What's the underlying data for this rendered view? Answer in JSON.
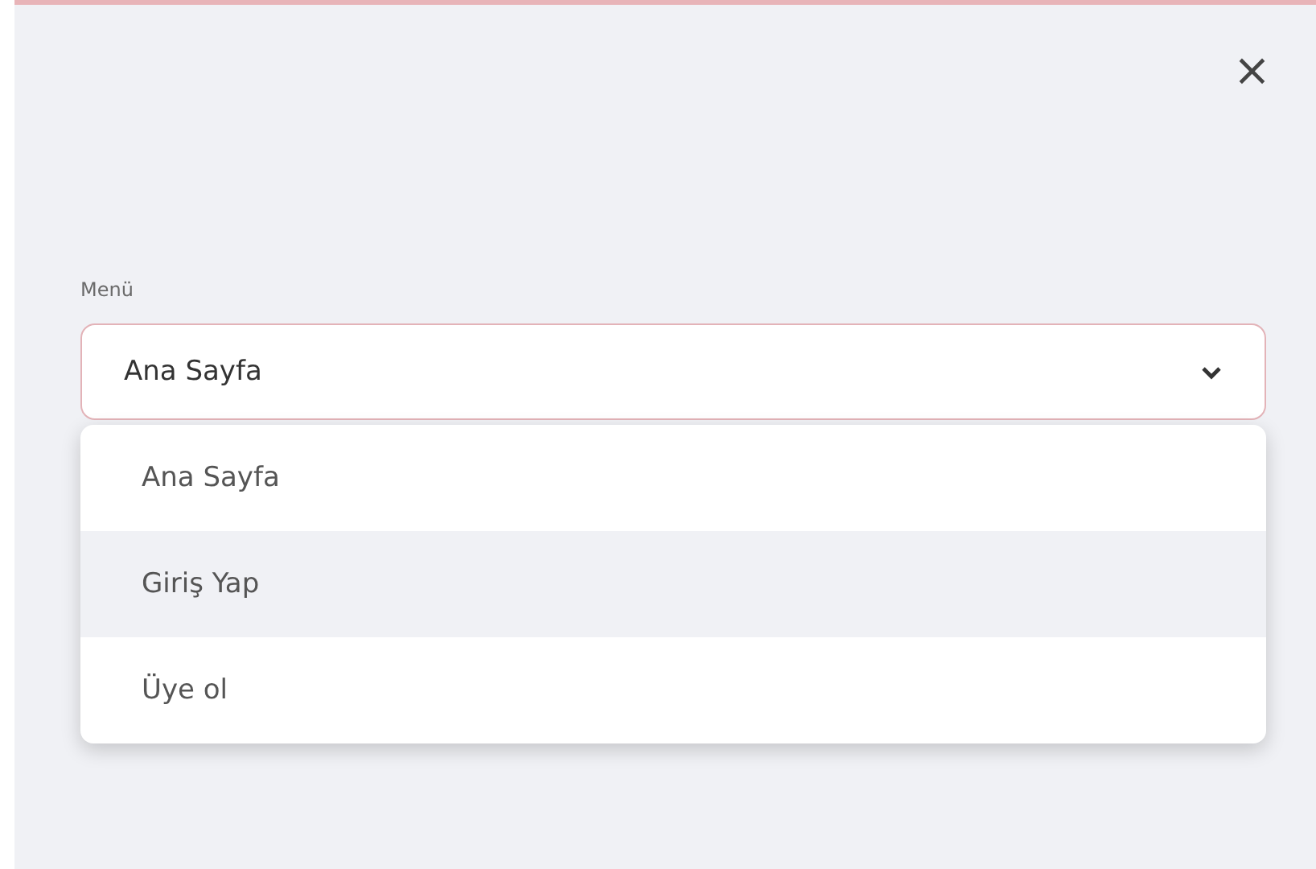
{
  "close_button": {
    "label": "×"
  },
  "menu": {
    "label": "Menü",
    "value": "Ana Sayfa",
    "expanded": true,
    "options": [
      {
        "label": "Ana Sayfa",
        "highlighted": false
      },
      {
        "label": "Giriş Yap",
        "highlighted": true
      },
      {
        "label": "Üye ol",
        "highlighted": false
      }
    ]
  }
}
